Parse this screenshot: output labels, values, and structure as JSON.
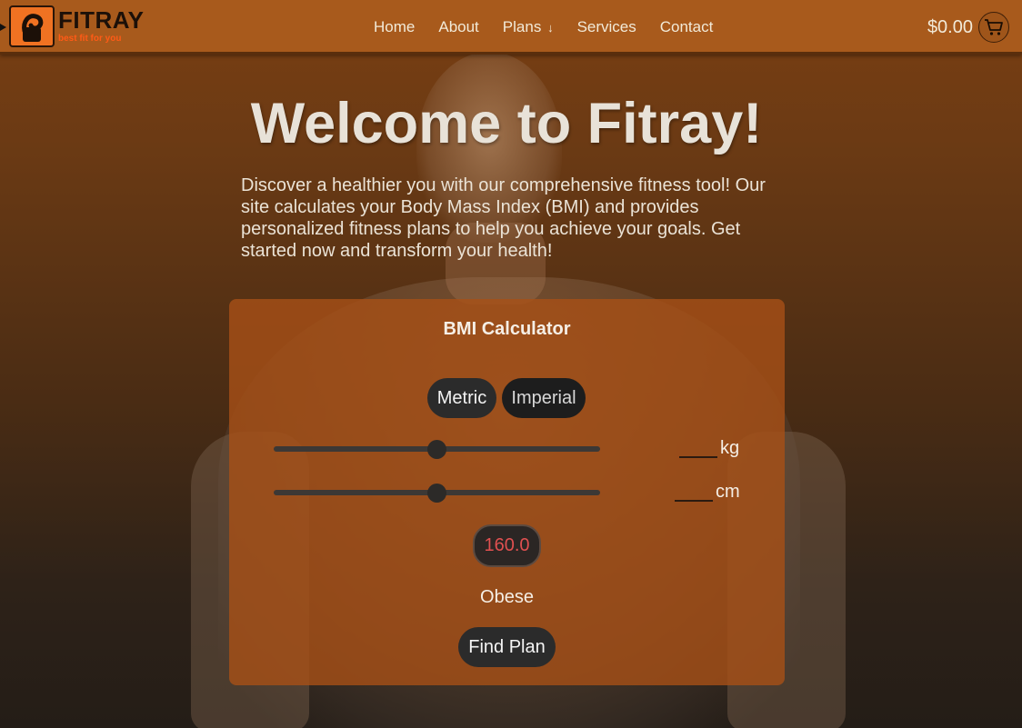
{
  "header": {
    "logo_name": "FITRAY",
    "logo_tagline": "best fit for you",
    "nav": [
      {
        "label": "Home"
      },
      {
        "label": "About"
      },
      {
        "label": "Plans"
      },
      {
        "label": "Services"
      },
      {
        "label": "Contact"
      }
    ],
    "plans_arrow": "↓",
    "cart_total": "$0.00"
  },
  "hero": {
    "title": "Welcome to Fitray!",
    "text": "Discover a healthier you with our comprehensive fitness tool! Our site calculates your Body Mass Index (BMI) and provides personalized fitness plans to help you achieve your goals. Get started now and transform your health!"
  },
  "calculator": {
    "title": "BMI Calculator",
    "metric_label": "Metric",
    "imperial_label": "Imperial",
    "weight": {
      "unit": "kg",
      "value": "",
      "slider_fraction": 0.5
    },
    "height": {
      "unit": "cm",
      "value": "",
      "slider_fraction": 0.5
    },
    "bmi_value": "160.0",
    "bmi_category": "Obese",
    "find_plan_label": "Find Plan"
  },
  "colors": {
    "header_bg": "#a85a1c",
    "logo_accent": "#f07222",
    "panel_bg": "#a75016",
    "bmi_value_text": "#e05050",
    "button_dark": "#2b2b2b"
  },
  "icons": {
    "logo": "flexed-arm-logo-icon",
    "cart": "shopping-cart-icon"
  }
}
